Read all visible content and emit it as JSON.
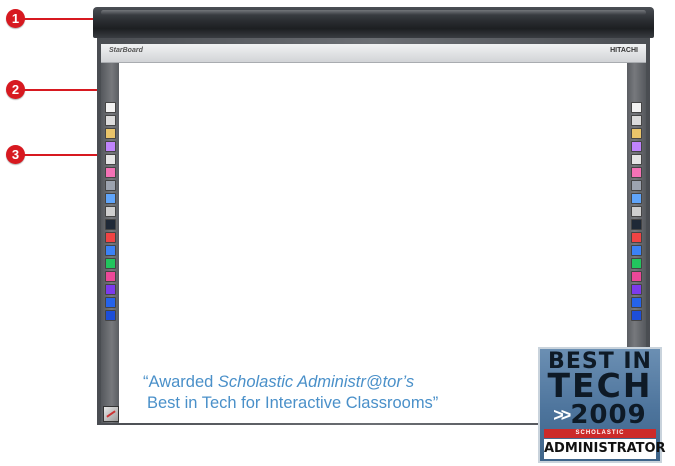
{
  "callouts": [
    {
      "number": "1"
    },
    {
      "number": "2"
    },
    {
      "number": "3"
    }
  ],
  "board": {
    "brand_left": "StarBoard",
    "brand_right": "HITACHI",
    "tool_colors": [
      "#f2f2f2",
      "#dcdcdc",
      "#e9c46a",
      "#c084fc",
      "#e5e5e5",
      "#f472b6",
      "#9ca3af",
      "#60a5fa",
      "#cfcfcf",
      "#1f2937",
      "#ef4444",
      "#3b82f6",
      "#22c55e",
      "#ec4899",
      "#7c3aed",
      "#2563eb",
      "#1d4ed8"
    ]
  },
  "quote": {
    "open": "“Awarded ",
    "publication": "Scholastic Administr@tor’s",
    "line2": "Best in Tech for Interactive Classrooms”"
  },
  "badge": {
    "line1": "BEST IN",
    "line2": "TECH",
    "arrows": ">>",
    "year": "2009",
    "small": "SCHOLASTIC",
    "name": "ADMINISTRATOR"
  }
}
